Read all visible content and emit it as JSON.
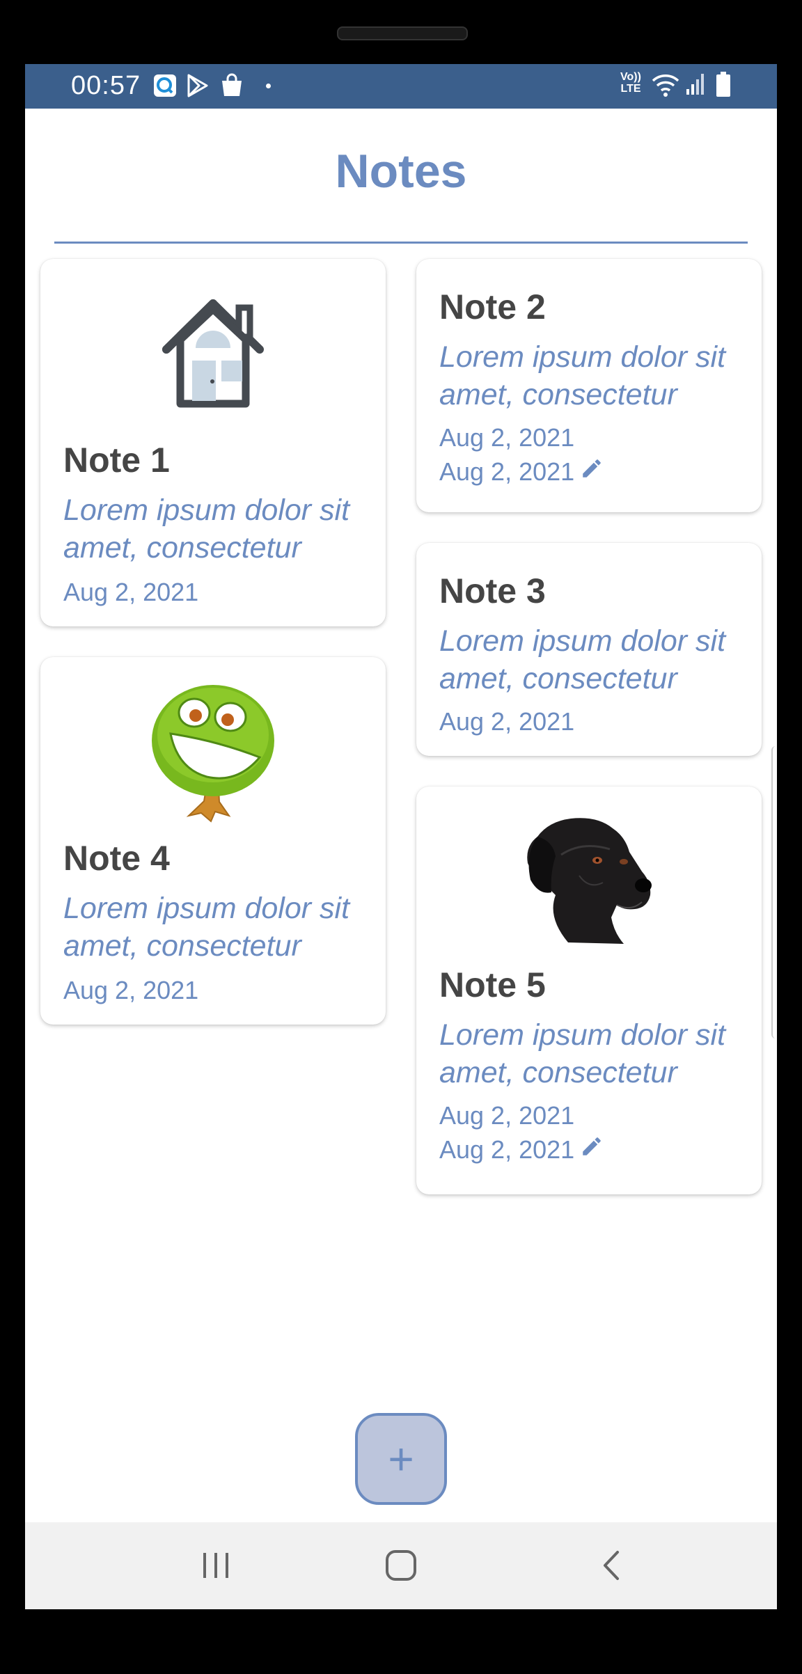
{
  "status_bar": {
    "time": "00:57",
    "network_label": "Vo)) LTE",
    "icons": [
      "app-q-icon",
      "play-store-icon",
      "shopping-bag-icon",
      "dot-icon",
      "volte-icon",
      "wifi-icon",
      "signal-icon",
      "battery-icon"
    ]
  },
  "header": {
    "title": "Notes"
  },
  "notes": [
    {
      "title": "Note 1",
      "body": "Lorem ipsum dolor sit amet, consectetur",
      "created": "Aug 2, 2021",
      "image": "house-icon"
    },
    {
      "title": "Note 2",
      "body": "Lorem ipsum dolor sit amet, consectetur",
      "created": "Aug 2, 2021",
      "edited": "Aug 2, 2021"
    },
    {
      "title": "Note 3",
      "body": "Lorem ipsum dolor sit amet, consectetur",
      "created": "Aug 2, 2021"
    },
    {
      "title": "Note 4",
      "body": "Lorem ipsum dolor sit amet, consectetur",
      "created": "Aug 2, 2021",
      "image": "smiling-tree-icon"
    },
    {
      "title": "Note 5",
      "body": "Lorem ipsum dolor sit amet, consectetur",
      "created": "Aug 2, 2021",
      "edited": "Aug 2, 2021",
      "image": "black-dog-icon"
    }
  ],
  "fab": {
    "label": "+",
    "icon": "plus-icon"
  },
  "nav_bar": {
    "icons": [
      "recent-apps-icon",
      "home-icon",
      "back-icon"
    ]
  },
  "colors": {
    "accent": "#6b8bc0",
    "status_bar": "#3b5f8c",
    "title_text": "#454545",
    "fab_fill": "#bcc5dc",
    "nav_bar": "#f1f1f1"
  }
}
